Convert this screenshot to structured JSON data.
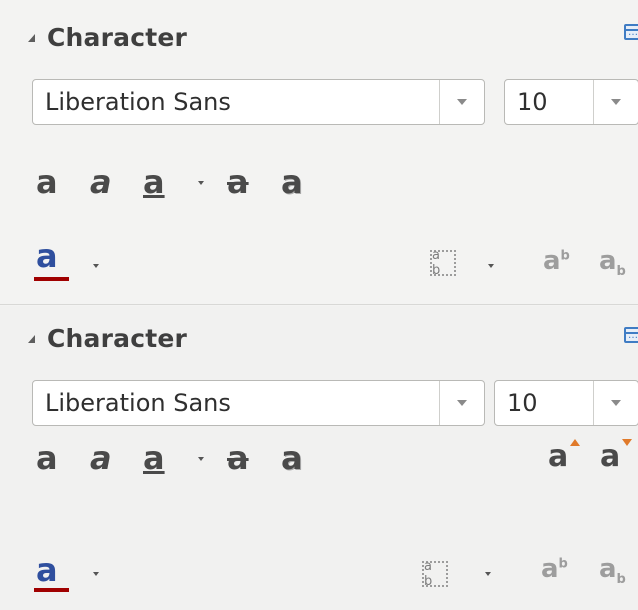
{
  "panels": [
    {
      "title": "Character",
      "font_name": {
        "value": "Liberation Sans"
      },
      "font_size": {
        "value": "10"
      },
      "format_buttons": [
        {
          "name": "bold",
          "glyph": "a"
        },
        {
          "name": "italic",
          "glyph": "a"
        },
        {
          "name": "underline",
          "glyph": "a"
        },
        {
          "name": "strikethrough",
          "glyph": "a"
        },
        {
          "name": "shadow",
          "glyph": "a"
        }
      ],
      "font_color": {
        "glyph": "a",
        "color": "#a00000"
      },
      "spacing_glyph": "a b",
      "superscript": {
        "base": "a",
        "mark": "b"
      },
      "subscript": {
        "base": "a",
        "mark": "b"
      }
    },
    {
      "title": "Character",
      "font_name": {
        "value": "Liberation Sans"
      },
      "font_size": {
        "value": "10"
      },
      "format_buttons": [
        {
          "name": "bold",
          "glyph": "a"
        },
        {
          "name": "italic",
          "glyph": "a"
        },
        {
          "name": "underline",
          "glyph": "a"
        },
        {
          "name": "strikethrough",
          "glyph": "a"
        },
        {
          "name": "shadow",
          "glyph": "a"
        }
      ],
      "grow_font": {
        "glyph": "a",
        "color": "#e07a2a"
      },
      "shrink_font": {
        "glyph": "a",
        "color": "#e07a2a"
      },
      "font_color": {
        "glyph": "a",
        "color": "#a00000"
      },
      "spacing_glyph": "a b",
      "superscript": {
        "base": "a",
        "mark": "b"
      },
      "subscript": {
        "base": "a",
        "mark": "b"
      }
    }
  ],
  "icons": {
    "collapse": "collapse-triangle-icon",
    "more_options": "more-options-icon",
    "dropdown": "chevron-down-icon"
  }
}
